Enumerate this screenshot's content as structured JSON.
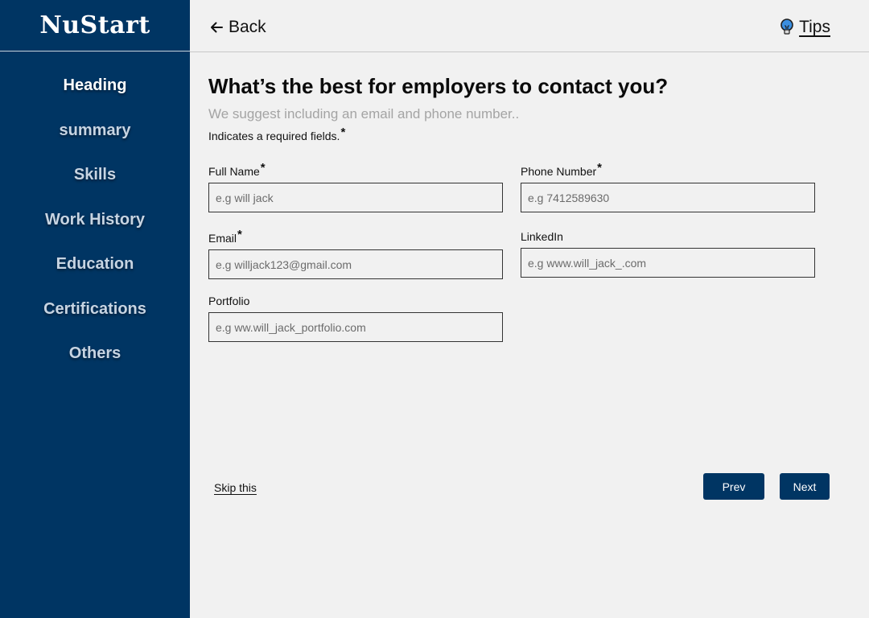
{
  "app": {
    "brand": "NuStart"
  },
  "sidebar": {
    "items": [
      {
        "label": "Heading",
        "active": true
      },
      {
        "label": "summary"
      },
      {
        "label": "Skills"
      },
      {
        "label": "Work History"
      },
      {
        "label": "Education"
      },
      {
        "label": "Certifications"
      },
      {
        "label": "Others"
      }
    ]
  },
  "topbar": {
    "back_label": "Back",
    "tips_label": "Tips"
  },
  "form": {
    "title": "What’s the best for employers to contact you?",
    "subtitle": "We suggest including an email and phone number..",
    "required_note": "Indicates a required fields.",
    "required_marker": "*",
    "fields": {
      "full_name": {
        "label": "Full Name",
        "placeholder": "e.g will jack",
        "required": true
      },
      "phone": {
        "label": "Phone Number",
        "placeholder": "e.g 7412589630",
        "required": true
      },
      "email": {
        "label": "Email",
        "placeholder": "e.g willjack123@gmail.com",
        "required": true
      },
      "linkedin": {
        "label": "LinkedIn",
        "placeholder": "e.g www.will_jack_.com",
        "required": false
      },
      "portfolio": {
        "label": "Portfolio",
        "placeholder": "e.g ww.will_jack_portfolio.com",
        "required": false
      }
    }
  },
  "footer": {
    "skip_label": "Skip this",
    "prev_label": "Prev",
    "next_label": "Next"
  },
  "colors": {
    "primary": "#003563",
    "background": "#f1f1f1",
    "muted_text": "#a4a4a4",
    "tips_icon": "#3b8fe0"
  },
  "icons": {
    "back": "arrow-left-icon",
    "tips": "lightbulb-icon"
  }
}
